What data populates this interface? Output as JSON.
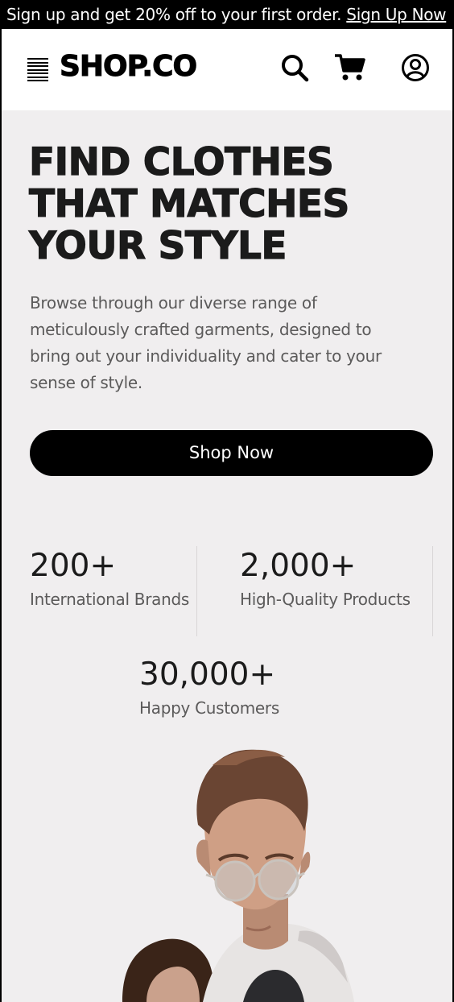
{
  "promo": {
    "text": "Sign up and get 20% off to your first order. ",
    "link_label": "Sign Up Now"
  },
  "header": {
    "logo": "SHOP.CO",
    "icons": [
      "menu-icon",
      "search-icon",
      "cart-icon",
      "account-icon"
    ]
  },
  "hero": {
    "title_lines": [
      "FIND CLOTHES",
      "THAT MATCHES",
      "YOUR STYLE"
    ],
    "description": "Browse through our diverse range of meticulously crafted garments, designed to bring out your individuality and cater to your sense of style.",
    "cta_label": "Shop Now"
  },
  "stats": [
    {
      "value": "200+",
      "label": "International Brands"
    },
    {
      "value": "2,000+",
      "label": "High-Quality Products"
    },
    {
      "value": "30,000+",
      "label": "Happy Customers"
    }
  ],
  "colors": {
    "background": "#f0eeef",
    "primary": "#000000",
    "heading": "#1b1b1b",
    "muted_text": "#5b5a5a"
  }
}
